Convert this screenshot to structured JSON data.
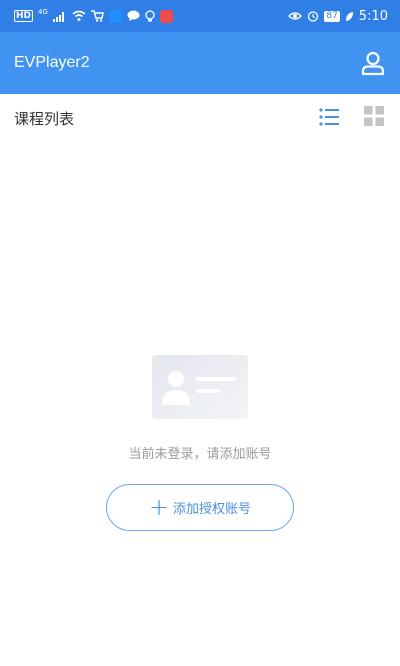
{
  "status_bar": {
    "hd": "HD",
    "network": "4G",
    "battery": "87",
    "time": "5:10"
  },
  "app_bar": {
    "title": "EVPlayer2",
    "user_icon": "user-icon"
  },
  "section": {
    "title": "课程列表",
    "list_view_icon": "list-view-icon",
    "grid_view_icon": "grid-view-icon",
    "active_view": "list"
  },
  "empty_state": {
    "illustration_icon": "id-card-icon",
    "message": "当前未登录，请添加账号",
    "add_button_label": "添加授权账号"
  },
  "colors": {
    "status_bar": "#2f7fe6",
    "app_bar": "#4193f2",
    "accent": "#4a90e2"
  }
}
